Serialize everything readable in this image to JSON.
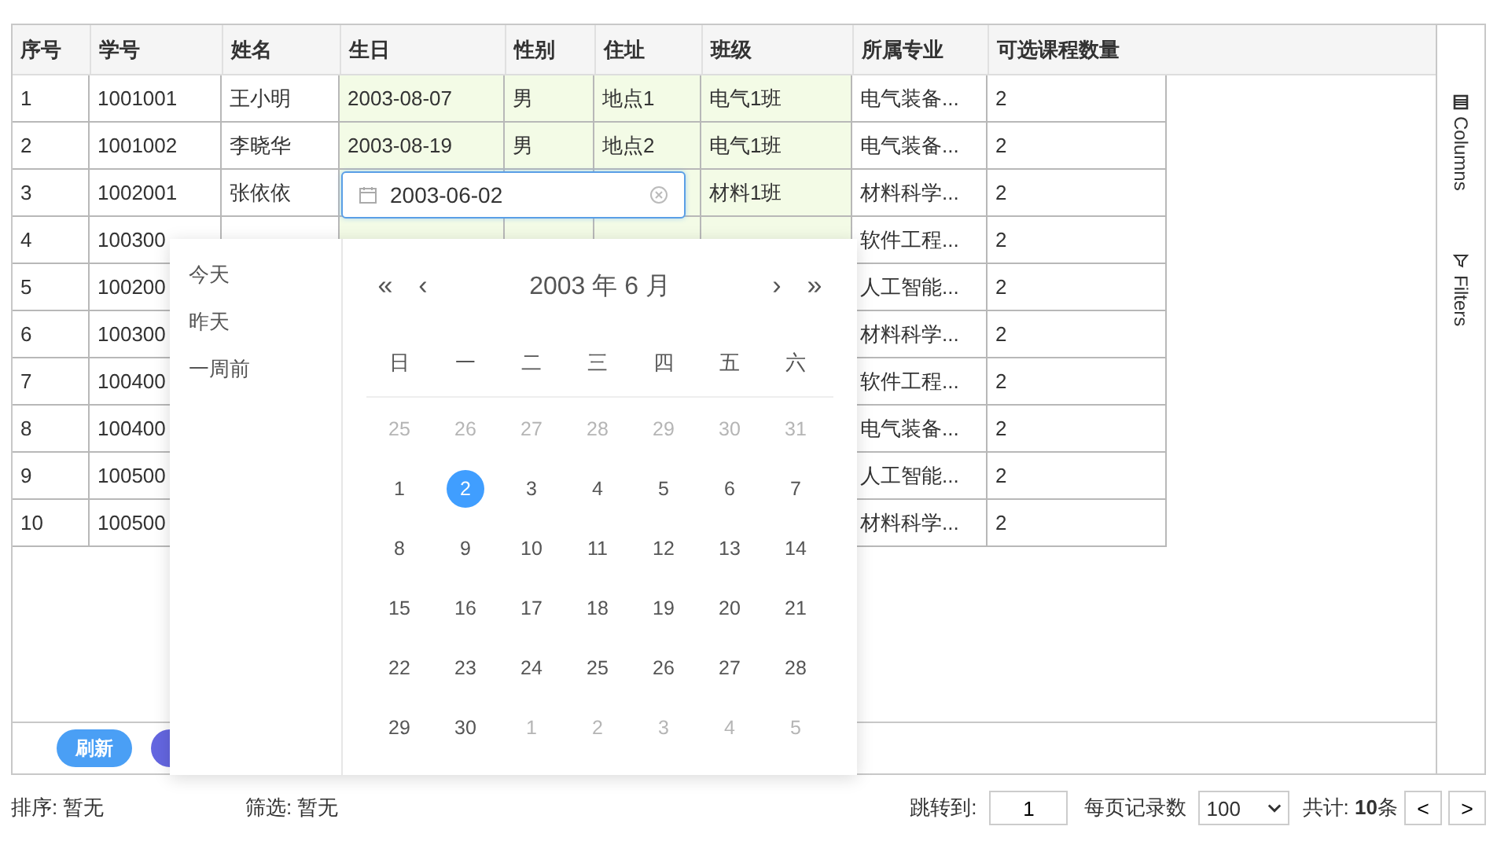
{
  "table": {
    "columns": [
      {
        "label": "序号",
        "editable": false
      },
      {
        "label": "学号",
        "editable": false
      },
      {
        "label": "姓名",
        "editable": false
      },
      {
        "label": "生日",
        "editable": true
      },
      {
        "label": "性别",
        "editable": true
      },
      {
        "label": "住址",
        "editable": true
      },
      {
        "label": "班级",
        "editable": true
      },
      {
        "label": "所属专业",
        "editable": false
      },
      {
        "label": "可选课程数量",
        "editable": false
      }
    ],
    "rows": [
      {
        "cells": [
          "1",
          "1001001",
          "王小明",
          "2003-08-07",
          "男",
          "地点1",
          "电气1班",
          "电气装备...",
          "2"
        ]
      },
      {
        "cells": [
          "2",
          "1001002",
          "李晓华",
          "2003-08-19",
          "男",
          "地点2",
          "电气1班",
          "电气装备...",
          "2"
        ]
      },
      {
        "cells": [
          "3",
          "1002001",
          "张依依",
          null,
          null,
          null,
          "材料1班",
          "材料科学...",
          "2"
        ]
      },
      {
        "cells": [
          "4",
          "100300",
          null,
          null,
          null,
          null,
          null,
          "软件工程...",
          "2"
        ]
      },
      {
        "cells": [
          "5",
          "100200",
          null,
          null,
          null,
          null,
          null,
          "人工智能...",
          "2"
        ]
      },
      {
        "cells": [
          "6",
          "100300",
          null,
          null,
          null,
          null,
          null,
          "材料科学...",
          "2"
        ]
      },
      {
        "cells": [
          "7",
          "100400",
          null,
          null,
          null,
          null,
          null,
          "软件工程...",
          "2"
        ]
      },
      {
        "cells": [
          "8",
          "100400",
          null,
          null,
          null,
          null,
          null,
          "电气装备...",
          "2"
        ]
      },
      {
        "cells": [
          "9",
          "100500",
          null,
          null,
          null,
          null,
          null,
          "人工智能...",
          "2"
        ]
      },
      {
        "cells": [
          "10",
          "100500",
          null,
          null,
          null,
          null,
          null,
          "材料科学...",
          "2"
        ]
      }
    ],
    "editor": {
      "value": "2003-06-02"
    },
    "buttons": [
      {
        "label": "刷新",
        "color": "#4a9ff5"
      },
      {
        "color": "#6466e0"
      }
    ]
  },
  "side_panel": [
    {
      "kind": "columns",
      "label": "Columns"
    },
    {
      "kind": "filters",
      "label": "Filters"
    }
  ],
  "date_picker": {
    "shortcuts": [
      "今天",
      "昨天",
      "一周前"
    ],
    "nav": [
      "«",
      "‹",
      "›",
      "»"
    ],
    "title": "2003 年  6 月",
    "weekdays": [
      "日",
      "一",
      "二",
      "三",
      "四",
      "五",
      "六"
    ],
    "weeks": [
      {
        "days": [
          {
            "label": "25",
            "in_month": false,
            "selected": false
          },
          {
            "label": "26",
            "in_month": false,
            "selected": false
          },
          {
            "label": "27",
            "in_month": false,
            "selected": false
          },
          {
            "label": "28",
            "in_month": false,
            "selected": false
          },
          {
            "label": "29",
            "in_month": false,
            "selected": false
          },
          {
            "label": "30",
            "in_month": false,
            "selected": false
          },
          {
            "label": "31",
            "in_month": false,
            "selected": false
          }
        ]
      },
      {
        "days": [
          {
            "label": "1",
            "in_month": true,
            "selected": false
          },
          {
            "label": "2",
            "in_month": true,
            "selected": true
          },
          {
            "label": "3",
            "in_month": true,
            "selected": false
          },
          {
            "label": "4",
            "in_month": true,
            "selected": false
          },
          {
            "label": "5",
            "in_month": true,
            "selected": false
          },
          {
            "label": "6",
            "in_month": true,
            "selected": false
          },
          {
            "label": "7",
            "in_month": true,
            "selected": false
          }
        ]
      },
      {
        "days": [
          {
            "label": "8",
            "in_month": true,
            "selected": false
          },
          {
            "label": "9",
            "in_month": true,
            "selected": false
          },
          {
            "label": "10",
            "in_month": true,
            "selected": false
          },
          {
            "label": "11",
            "in_month": true,
            "selected": false
          },
          {
            "label": "12",
            "in_month": true,
            "selected": false
          },
          {
            "label": "13",
            "in_month": true,
            "selected": false
          },
          {
            "label": "14",
            "in_month": true,
            "selected": false
          }
        ]
      },
      {
        "days": [
          {
            "label": "15",
            "in_month": true,
            "selected": false
          },
          {
            "label": "16",
            "in_month": true,
            "selected": false
          },
          {
            "label": "17",
            "in_month": true,
            "selected": false
          },
          {
            "label": "18",
            "in_month": true,
            "selected": false
          },
          {
            "label": "19",
            "in_month": true,
            "selected": false
          },
          {
            "label": "20",
            "in_month": true,
            "selected": false
          },
          {
            "label": "21",
            "in_month": true,
            "selected": false
          }
        ]
      },
      {
        "days": [
          {
            "label": "22",
            "in_month": true,
            "selected": false
          },
          {
            "label": "23",
            "in_month": true,
            "selected": false
          },
          {
            "label": "24",
            "in_month": true,
            "selected": false
          },
          {
            "label": "25",
            "in_month": true,
            "selected": false
          },
          {
            "label": "26",
            "in_month": true,
            "selected": false
          },
          {
            "label": "27",
            "in_month": true,
            "selected": false
          },
          {
            "label": "28",
            "in_month": true,
            "selected": false
          }
        ]
      },
      {
        "days": [
          {
            "label": "29",
            "in_month": true,
            "selected": false
          },
          {
            "label": "30",
            "in_month": true,
            "selected": false
          },
          {
            "label": "1",
            "in_month": false,
            "selected": false
          },
          {
            "label": "2",
            "in_month": false,
            "selected": false
          },
          {
            "label": "3",
            "in_month": false,
            "selected": false
          },
          {
            "label": "4",
            "in_month": false,
            "selected": false
          },
          {
            "label": "5",
            "in_month": false,
            "selected": false
          }
        ]
      }
    ]
  },
  "status": {
    "sort": "排序: 暂无",
    "filter": "筛选: 暂无"
  },
  "pagination": {
    "jump_label": "跳转到:",
    "page": "1",
    "size_label": "每页记录数",
    "size": "100",
    "total": "共计: **10**条",
    "prev": "<",
    "next": ">"
  }
}
